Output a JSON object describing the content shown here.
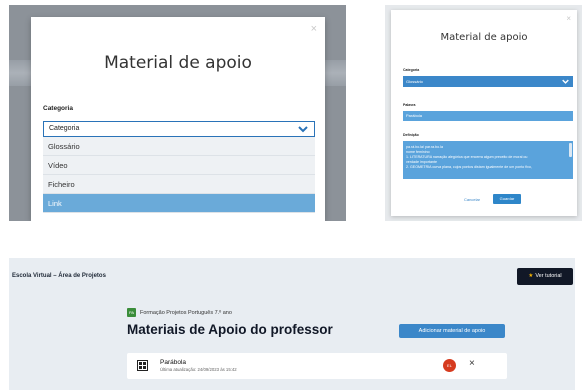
{
  "panel1": {
    "close_glyph": "×",
    "modal_title": "Material de apoio",
    "category_label": "Categoria",
    "select_value": "Categoria",
    "options": [
      "Glossário",
      "Vídeo",
      "Ficheiro",
      "Link"
    ],
    "selected_option": "Link"
  },
  "panel2": {
    "close_glyph": "×",
    "modal_title": "Material de apoio",
    "category_label": "Categoria",
    "category_value": "Glossário",
    "word_label": "Palavra",
    "word_value": "Parábola",
    "definition_label": "Definição",
    "definition_lines": [
      "pa.rá.bo.la/ par.ra.bo.la",
      "nome feminino",
      "1.   LITERATURA narração alegórica que encerra algum preceito de moral ou",
      "verdade importante",
      "2.   GEOMETRIA curva plana, cujos pontos distam igualmente de um ponto fixo,"
    ],
    "cancel_label": "Cancelar",
    "save_label": "Guardar"
  },
  "panel3": {
    "app_title": "Escola Virtual – Área de Projetos",
    "tutorial_label": "Ver tutorial",
    "tutorial_star": "★",
    "badge_text": "PA",
    "breadcrumb": "Formação Projetos Português 7.º ano",
    "page_title": "Materiais de Apoio do professor",
    "add_button": "Adicionar material de apoio",
    "item": {
      "name": "Parábola",
      "updated": "Última atualização: 24/09/2023 às 15:42",
      "delete_badge": "EL",
      "remove_glyph": "×"
    }
  },
  "colors": {
    "accent_blue": "#3b87c9",
    "selected_option": "#6aaad9",
    "delete_red": "#d63b1f",
    "dark_button": "#111827",
    "badge_green": "#3a8d3a"
  }
}
